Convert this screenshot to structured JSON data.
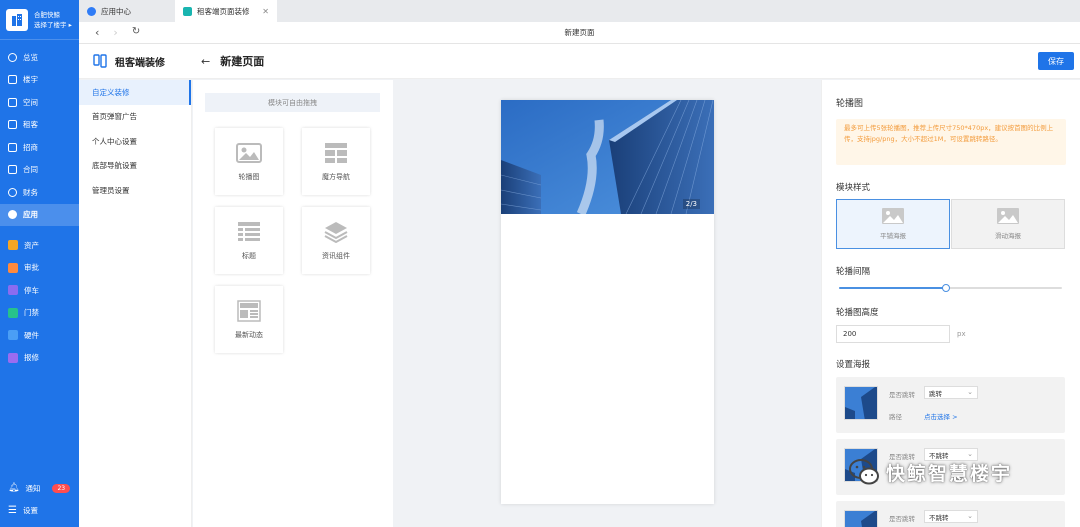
{
  "sidebar": {
    "brand_line1": "合肥快鲸",
    "brand_line2": "选择了楼宇 ▸",
    "items": [
      {
        "label": "总览"
      },
      {
        "label": "楼宇"
      },
      {
        "label": "空间"
      },
      {
        "label": "租客"
      },
      {
        "label": "招商"
      },
      {
        "label": "合同"
      },
      {
        "label": "财务"
      },
      {
        "label": "应用"
      },
      {
        "label": "资产"
      },
      {
        "label": "审批"
      },
      {
        "label": "停车"
      },
      {
        "label": "门禁"
      },
      {
        "label": "硬件"
      },
      {
        "label": "报修"
      }
    ],
    "notify_label": "通知",
    "notify_count": "23",
    "settings_label": "设置",
    "icon_colors": [
      "#f5a623",
      "#ff8a3d",
      "#8b6cf0",
      "#27c28a",
      "#4a9ef5",
      "#9b6cf0"
    ]
  },
  "tabs": [
    {
      "label": "应用中心"
    },
    {
      "label": "租客端页面装修"
    }
  ],
  "address": {
    "title": "新建页面"
  },
  "header": {
    "app_name": "租客端装修",
    "page_title": "新建页面",
    "save_label": "保存"
  },
  "settings_menu": [
    {
      "label": "自定义装修"
    },
    {
      "label": "首页弹窗广告"
    },
    {
      "label": "个人中心设置"
    },
    {
      "label": "底部导航设置"
    },
    {
      "label": "管理员设置"
    }
  ],
  "modules": {
    "drag_tip": "模块可自由拖拽",
    "items": [
      {
        "label": "轮播图",
        "icon": "image-icon"
      },
      {
        "label": "魔方导航",
        "icon": "grid-icon"
      },
      {
        "label": "标题",
        "icon": "list-icon"
      },
      {
        "label": "资讯组件",
        "icon": "layers-icon"
      },
      {
        "label": "最新动态",
        "icon": "news-icon"
      }
    ]
  },
  "preview": {
    "counter": "2/3"
  },
  "config": {
    "section_title": "轮播图",
    "notice": "最多可上传5张轮播图，推荐上传尺寸750*470px，建议按首图的比例上传，支持jpg/png，大小不超过1M，可设置跳转路径。",
    "style_label": "模块样式",
    "style_options": [
      {
        "label": "平铺海报"
      },
      {
        "label": "滑动海报"
      }
    ],
    "interval_label": "轮播间隔",
    "interval_value": 0.48,
    "height_label": "轮播图高度",
    "height_value": "200",
    "height_unit": "px",
    "poster_label": "设置海报",
    "posters": [
      {
        "jump_label": "是否跳转",
        "jump_value": "跳转",
        "path_label": "路径",
        "path_link": "点击选择 >"
      },
      {
        "jump_label": "是否跳转",
        "jump_value": "不跳转"
      },
      {
        "jump_label": "是否跳转",
        "jump_value": "不跳转"
      }
    ]
  },
  "watermark": {
    "text": "快鲸智慧楼宇"
  },
  "colors": {
    "accent": "#1f74e8",
    "notice_bg": "#fff6e8",
    "notice_text": "#f39c3d"
  }
}
